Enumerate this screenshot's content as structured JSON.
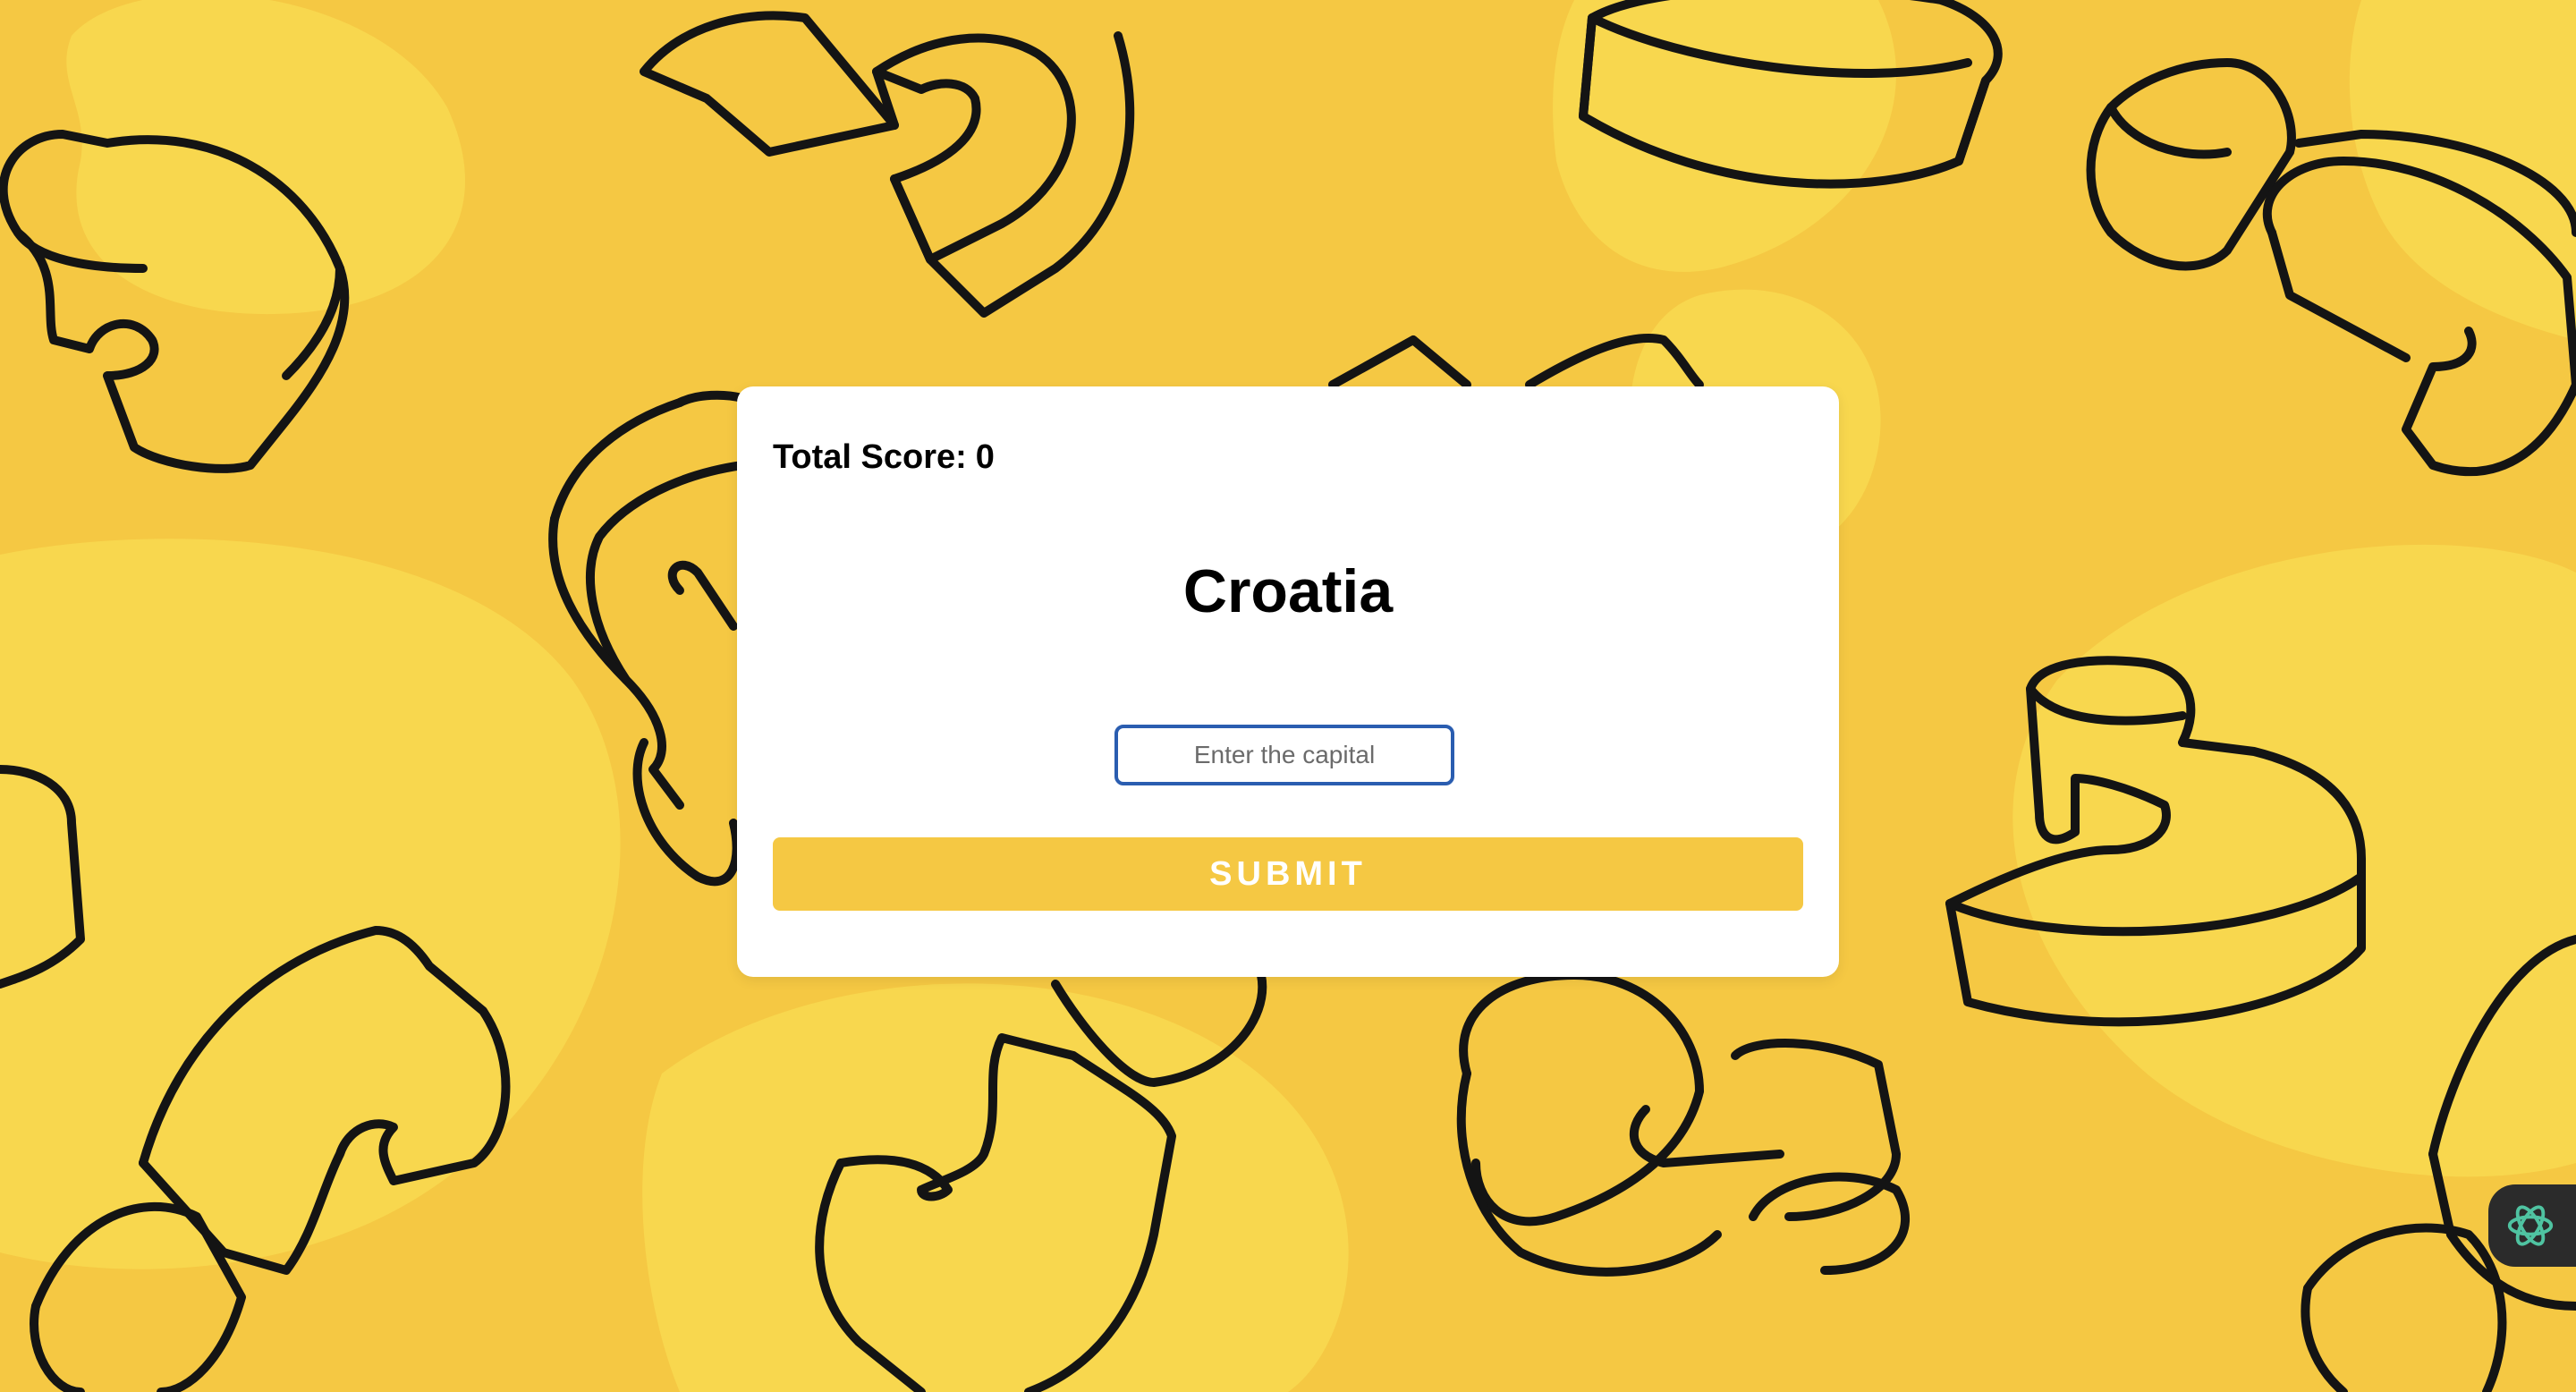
{
  "app": {
    "background_color": "#f5c843",
    "blob_color": "#f8d74e",
    "doodle_stroke_color": "#141414",
    "accent_color": "#f5c843",
    "input_border_color": "#2a5db0"
  },
  "score": {
    "label": "Total Score:",
    "value": "0"
  },
  "question": {
    "country": "Croatia"
  },
  "answer": {
    "value": "",
    "placeholder": "Enter the capital"
  },
  "actions": {
    "submit_label": "SUBMIT"
  },
  "assistant": {
    "icon": "openai-logo-icon",
    "icon_color": "#4fc3a1"
  }
}
